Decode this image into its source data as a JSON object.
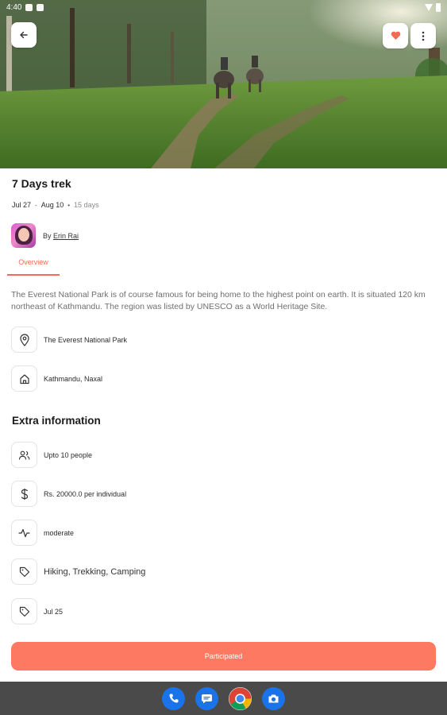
{
  "status_bar": {
    "time": "4:40"
  },
  "hero": {
    "image": "elephants-on-jungle-trail",
    "icons": {
      "back": "arrow-left-icon",
      "favorite": "heart-icon",
      "more": "more-vertical-icon"
    },
    "colors": {
      "heart": "#f26b55"
    }
  },
  "trip": {
    "title": "7 Days trek",
    "start_date": "Jul 27",
    "date_separator": "-",
    "end_date": "Aug 10",
    "dot": "•",
    "duration": "15 days",
    "author_prefix": "By",
    "author_name": "Erin Rai"
  },
  "tabs": [
    {
      "label": "Overview",
      "active": true
    }
  ],
  "overview": {
    "description": "The Everest National Park is of course famous for being home to the highest point on earth. It is situated 120 km northeast of Kathmandu. The region was listed by UNESCO as a World Heritage Site.",
    "location": {
      "icon": "map-pin-icon",
      "text": "The Everest National Park"
    },
    "address": {
      "icon": "home-icon",
      "text": "Kathmandu, Naxal"
    }
  },
  "extra": {
    "title": "Extra information",
    "items": [
      {
        "icon": "users-icon",
        "text": "Upto 10 people"
      },
      {
        "icon": "dollar-icon",
        "text": "Rs. 20000.0 per individual"
      },
      {
        "icon": "activity-icon",
        "text": "moderate"
      },
      {
        "icon": "tag-icon",
        "text": "Hiking, Trekking, Camping"
      },
      {
        "icon": "tag-icon",
        "text": "Jul 25"
      }
    ]
  },
  "cta": {
    "label": "Participated",
    "color": "#fe7962"
  },
  "nav_dock": [
    "phone-icon",
    "messages-icon",
    "chrome-icon",
    "camera-icon"
  ]
}
